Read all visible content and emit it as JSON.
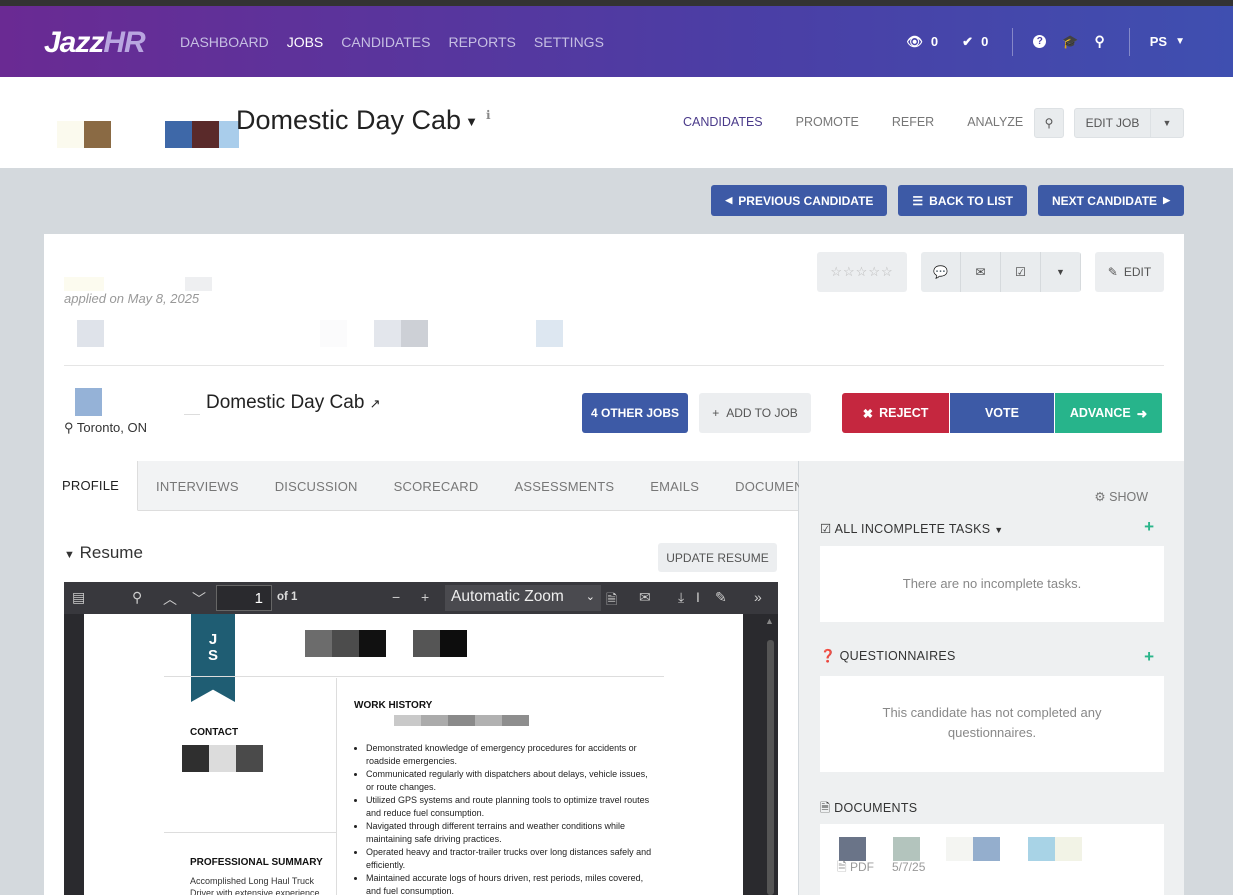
{
  "topbar": {
    "logo_main": "Jazz",
    "logo_accent": "HR",
    "nav": [
      "DASHBOARD",
      "JOBS",
      "CANDIDATES",
      "REPORTS",
      "SETTINGS"
    ],
    "views_count": "0",
    "checks_count": "0",
    "user_initials": "PS"
  },
  "job": {
    "title": "Domestic Day Cab",
    "tabs": [
      "CANDIDATES",
      "PROMOTE",
      "REFER",
      "ANALYZE"
    ],
    "edit_label": "EDIT JOB"
  },
  "navigation": {
    "prev": "PREVIOUS CANDIDATE",
    "back": "BACK TO LIST",
    "next": "NEXT CANDIDATE"
  },
  "candidate": {
    "applied": "applied on May 8, 2025",
    "job_title": "Domestic Day Cab",
    "location": "Toronto, ON",
    "edit": "EDIT",
    "other_jobs": "4 OTHER JOBS",
    "add_to_job": "ADD TO JOB",
    "reject": "REJECT",
    "vote": "VOTE",
    "advance": "ADVANCE"
  },
  "tabs": [
    "PROFILE",
    "INTERVIEWS",
    "DISCUSSION",
    "SCORECARD",
    "ASSESSMENTS",
    "EMAILS",
    "DOCUMENTS"
  ],
  "resume": {
    "heading": "Resume",
    "update": "UPDATE RESUME",
    "page": "1",
    "of": "of 1",
    "zoom": "Automatic Zoom",
    "initials_1": "J",
    "initials_2": "S",
    "contact": "CONTACT",
    "work_history": "WORK HISTORY",
    "summary": "PROFESSIONAL SUMMARY",
    "summary_text_1": "Accomplished Long Haul Truck",
    "summary_text_2": "Driver with extensive experience",
    "bullets": [
      "Demonstrated knowledge of emergency procedures for accidents or roadside emergencies.",
      "Communicated regularly with dispatchers about delays, vehicle issues, or route changes.",
      "Utilized GPS systems and route planning tools to optimize travel routes and reduce fuel consumption.",
      "Navigated through different terrains and weather conditions while maintaining safe driving practices.",
      "Operated heavy and tractor-trailer trucks over long distances safely and efficiently.",
      "Maintained accurate logs of hours driven, rest periods, miles covered, and fuel consumption."
    ]
  },
  "sidebar": {
    "show": "SHOW",
    "tasks_title": "ALL INCOMPLETE TASKS",
    "tasks_empty": "There are no incomplete tasks.",
    "quest_title": "QUESTIONNAIRES",
    "quest_empty_1": "This candidate has not completed any",
    "quest_empty_2": "questionnaires.",
    "docs_title": "DOCUMENTS",
    "doc_type": "PDF",
    "doc_date": "5/7/25"
  }
}
